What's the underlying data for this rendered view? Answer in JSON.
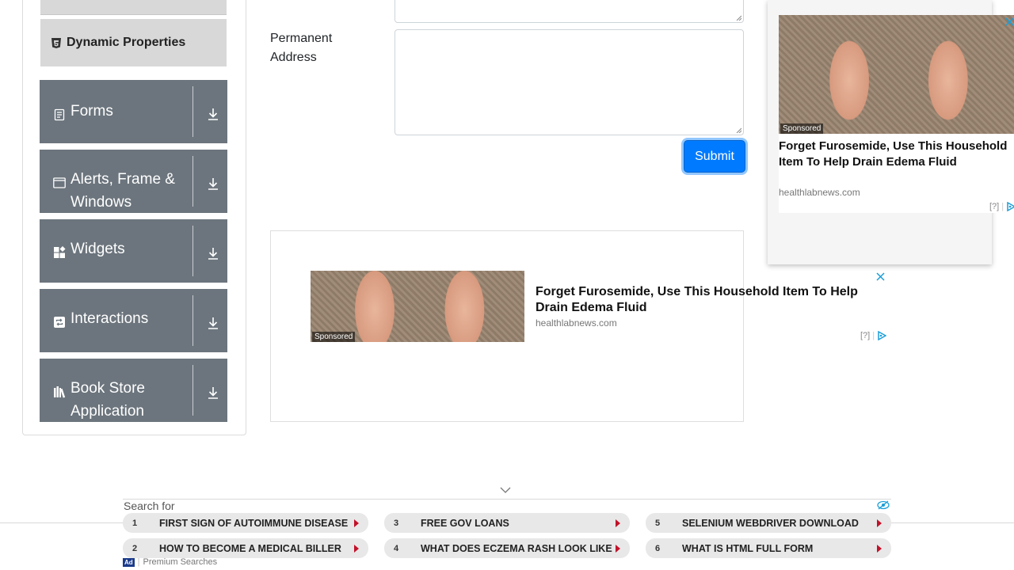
{
  "sidebar": {
    "active_subitem": "Dynamic Properties",
    "groups": [
      {
        "label": "Forms",
        "icon": "form-icon"
      },
      {
        "label": "Alerts, Frame & Windows",
        "icon": "window-icon"
      },
      {
        "label": "Widgets",
        "icon": "widgets-icon"
      },
      {
        "label": "Interactions",
        "icon": "interactions-icon"
      },
      {
        "label": "Book Store Application",
        "icon": "book-icon"
      }
    ]
  },
  "form": {
    "permanent_address_label": "Permanent Address",
    "submit_label": "Submit"
  },
  "ads": {
    "inline": {
      "sponsored": "Sponsored",
      "title": "Forget Furosemide, Use This Household Item To Help Drain Edema Fluid",
      "domain": "healthlabnews.com",
      "info": "[?]"
    },
    "side": {
      "sponsored": "Sponsored",
      "title": "Forget Furosemide, Use This Household Item To Help Drain Edema Fluid",
      "domain": "healthlabnews.com",
      "info": "[?]"
    }
  },
  "search_bar": {
    "heading": "Search for",
    "items": [
      {
        "num": "1",
        "text": "FIRST SIGN OF AUTOIMMUNE DISEASE"
      },
      {
        "num": "2",
        "text": "HOW TO BECOME A MEDICAL BILLER"
      },
      {
        "num": "3",
        "text": "FREE GOV LOANS"
      },
      {
        "num": "4",
        "text": "WHAT DOES ECZEMA RASH LOOK LIKE"
      },
      {
        "num": "5",
        "text": "SELENIUM WEBDRIVER DOWNLOAD"
      },
      {
        "num": "6",
        "text": "WHAT IS HTML FULL FORM"
      }
    ],
    "ad_badge": "Ad",
    "footer": "Premium Searches"
  },
  "colors": {
    "primary": "#007bff",
    "sidebar_group": "#6c757d",
    "search_arrow": "#c2122a"
  }
}
